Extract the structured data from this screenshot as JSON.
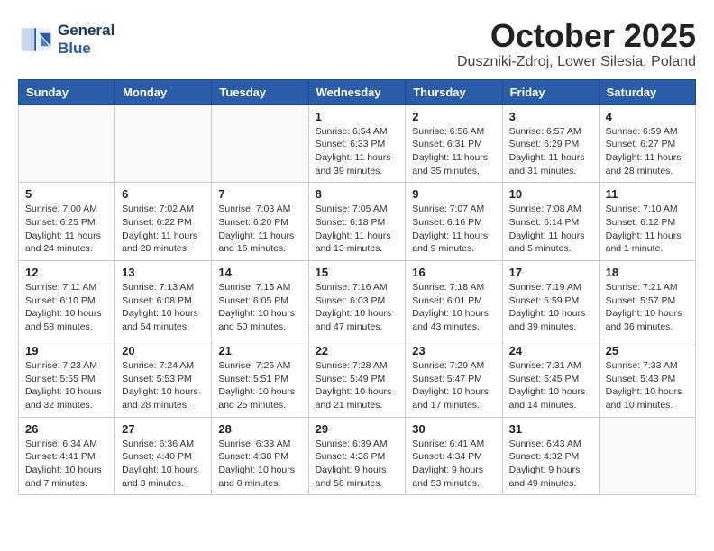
{
  "logo": {
    "line1": "General",
    "line2": "Blue"
  },
  "title": "October 2025",
  "subtitle": "Duszniki-Zdroj, Lower Silesia, Poland",
  "headers": [
    "Sunday",
    "Monday",
    "Tuesday",
    "Wednesday",
    "Thursday",
    "Friday",
    "Saturday"
  ],
  "weeks": [
    [
      {
        "day": "",
        "info": ""
      },
      {
        "day": "",
        "info": ""
      },
      {
        "day": "",
        "info": ""
      },
      {
        "day": "1",
        "info": "Sunrise: 6:54 AM\nSunset: 6:33 PM\nDaylight: 11 hours\nand 39 minutes."
      },
      {
        "day": "2",
        "info": "Sunrise: 6:56 AM\nSunset: 6:31 PM\nDaylight: 11 hours\nand 35 minutes."
      },
      {
        "day": "3",
        "info": "Sunrise: 6:57 AM\nSunset: 6:29 PM\nDaylight: 11 hours\nand 31 minutes."
      },
      {
        "day": "4",
        "info": "Sunrise: 6:59 AM\nSunset: 6:27 PM\nDaylight: 11 hours\nand 28 minutes."
      }
    ],
    [
      {
        "day": "5",
        "info": "Sunrise: 7:00 AM\nSunset: 6:25 PM\nDaylight: 11 hours\nand 24 minutes."
      },
      {
        "day": "6",
        "info": "Sunrise: 7:02 AM\nSunset: 6:22 PM\nDaylight: 11 hours\nand 20 minutes."
      },
      {
        "day": "7",
        "info": "Sunrise: 7:03 AM\nSunset: 6:20 PM\nDaylight: 11 hours\nand 16 minutes."
      },
      {
        "day": "8",
        "info": "Sunrise: 7:05 AM\nSunset: 6:18 PM\nDaylight: 11 hours\nand 13 minutes."
      },
      {
        "day": "9",
        "info": "Sunrise: 7:07 AM\nSunset: 6:16 PM\nDaylight: 11 hours\nand 9 minutes."
      },
      {
        "day": "10",
        "info": "Sunrise: 7:08 AM\nSunset: 6:14 PM\nDaylight: 11 hours\nand 5 minutes."
      },
      {
        "day": "11",
        "info": "Sunrise: 7:10 AM\nSunset: 6:12 PM\nDaylight: 11 hours\nand 1 minute."
      }
    ],
    [
      {
        "day": "12",
        "info": "Sunrise: 7:11 AM\nSunset: 6:10 PM\nDaylight: 10 hours\nand 58 minutes."
      },
      {
        "day": "13",
        "info": "Sunrise: 7:13 AM\nSunset: 6:08 PM\nDaylight: 10 hours\nand 54 minutes."
      },
      {
        "day": "14",
        "info": "Sunrise: 7:15 AM\nSunset: 6:05 PM\nDaylight: 10 hours\nand 50 minutes."
      },
      {
        "day": "15",
        "info": "Sunrise: 7:16 AM\nSunset: 6:03 PM\nDaylight: 10 hours\nand 47 minutes."
      },
      {
        "day": "16",
        "info": "Sunrise: 7:18 AM\nSunset: 6:01 PM\nDaylight: 10 hours\nand 43 minutes."
      },
      {
        "day": "17",
        "info": "Sunrise: 7:19 AM\nSunset: 5:59 PM\nDaylight: 10 hours\nand 39 minutes."
      },
      {
        "day": "18",
        "info": "Sunrise: 7:21 AM\nSunset: 5:57 PM\nDaylight: 10 hours\nand 36 minutes."
      }
    ],
    [
      {
        "day": "19",
        "info": "Sunrise: 7:23 AM\nSunset: 5:55 PM\nDaylight: 10 hours\nand 32 minutes."
      },
      {
        "day": "20",
        "info": "Sunrise: 7:24 AM\nSunset: 5:53 PM\nDaylight: 10 hours\nand 28 minutes."
      },
      {
        "day": "21",
        "info": "Sunrise: 7:26 AM\nSunset: 5:51 PM\nDaylight: 10 hours\nand 25 minutes."
      },
      {
        "day": "22",
        "info": "Sunrise: 7:28 AM\nSunset: 5:49 PM\nDaylight: 10 hours\nand 21 minutes."
      },
      {
        "day": "23",
        "info": "Sunrise: 7:29 AM\nSunset: 5:47 PM\nDaylight: 10 hours\nand 17 minutes."
      },
      {
        "day": "24",
        "info": "Sunrise: 7:31 AM\nSunset: 5:45 PM\nDaylight: 10 hours\nand 14 minutes."
      },
      {
        "day": "25",
        "info": "Sunrise: 7:33 AM\nSunset: 5:43 PM\nDaylight: 10 hours\nand 10 minutes."
      }
    ],
    [
      {
        "day": "26",
        "info": "Sunrise: 6:34 AM\nSunset: 4:41 PM\nDaylight: 10 hours\nand 7 minutes."
      },
      {
        "day": "27",
        "info": "Sunrise: 6:36 AM\nSunset: 4:40 PM\nDaylight: 10 hours\nand 3 minutes."
      },
      {
        "day": "28",
        "info": "Sunrise: 6:38 AM\nSunset: 4:38 PM\nDaylight: 10 hours\nand 0 minutes."
      },
      {
        "day": "29",
        "info": "Sunrise: 6:39 AM\nSunset: 4:36 PM\nDaylight: 9 hours\nand 56 minutes."
      },
      {
        "day": "30",
        "info": "Sunrise: 6:41 AM\nSunset: 4:34 PM\nDaylight: 9 hours\nand 53 minutes."
      },
      {
        "day": "31",
        "info": "Sunrise: 6:43 AM\nSunset: 4:32 PM\nDaylight: 9 hours\nand 49 minutes."
      },
      {
        "day": "",
        "info": ""
      }
    ]
  ]
}
